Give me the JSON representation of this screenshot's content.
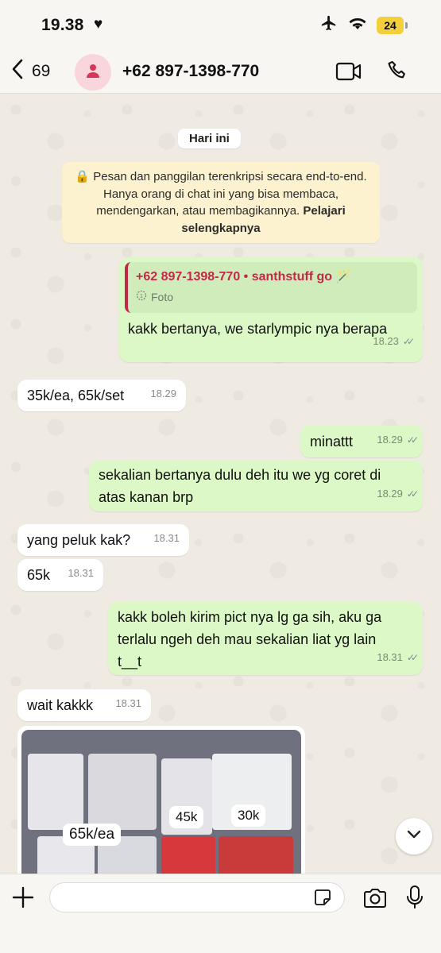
{
  "status_bar": {
    "time": "19.38",
    "heart": "♥",
    "battery": "24",
    "icons": [
      "airplane-icon",
      "wifi-icon",
      "battery-icon"
    ]
  },
  "header": {
    "back_count": "69",
    "contact": "+62 897-1398-770",
    "icons": [
      "chevron-left-icon",
      "person-icon",
      "video-call-icon",
      "phone-icon"
    ]
  },
  "chat": {
    "date_chip": "Hari ini",
    "encryption_notice": {
      "text": "Pesan dan panggilan terenkripsi secara end-to-end. Hanya orang di chat ini yang bisa membaca, mendengarkan, atau membagikannya.",
      "link": "Pelajari selengkapnya"
    },
    "reply_message": {
      "quote_name": "+62 897-1398-770 • santhstuff go 🪄",
      "quote_type": "Foto",
      "text": "kakk bertanya, we starlympic nya berapa",
      "time": "18.23"
    },
    "messages": [
      {
        "dir": "in",
        "text": "35k/ea, 65k/set",
        "time": "18.29"
      },
      {
        "dir": "out",
        "text": "minattt",
        "time": "18.29"
      },
      {
        "dir": "out",
        "text": "sekalian bertanya dulu deh itu we yg coret di atas kanan brp",
        "time": "18.29"
      },
      {
        "dir": "in",
        "text": "yang peluk kak?",
        "time": "18.31"
      },
      {
        "dir": "in",
        "text": "65k",
        "time": "18.31"
      },
      {
        "dir": "out",
        "text": "kakk boleh kirim pict nya lg ga sih, aku ga terlalu ngeh deh mau sekalian liat yg lain t__t",
        "time": "18.31"
      },
      {
        "dir": "in",
        "text": "wait kakkk",
        "time": "18.31"
      }
    ],
    "photo_labels": [
      "65k/ea",
      "45k",
      "30k"
    ]
  },
  "input_bar": {
    "placeholder": "",
    "icons": [
      "plus-icon",
      "sticker-icon",
      "camera-icon",
      "microphone-icon"
    ]
  },
  "colors": {
    "outgoing_bubble": "#dcf8c6",
    "incoming_bubble": "#ffffff",
    "quote_accent": "#c52748",
    "notice_bg": "#fdf2cf",
    "chat_bg": "#efeae2"
  }
}
